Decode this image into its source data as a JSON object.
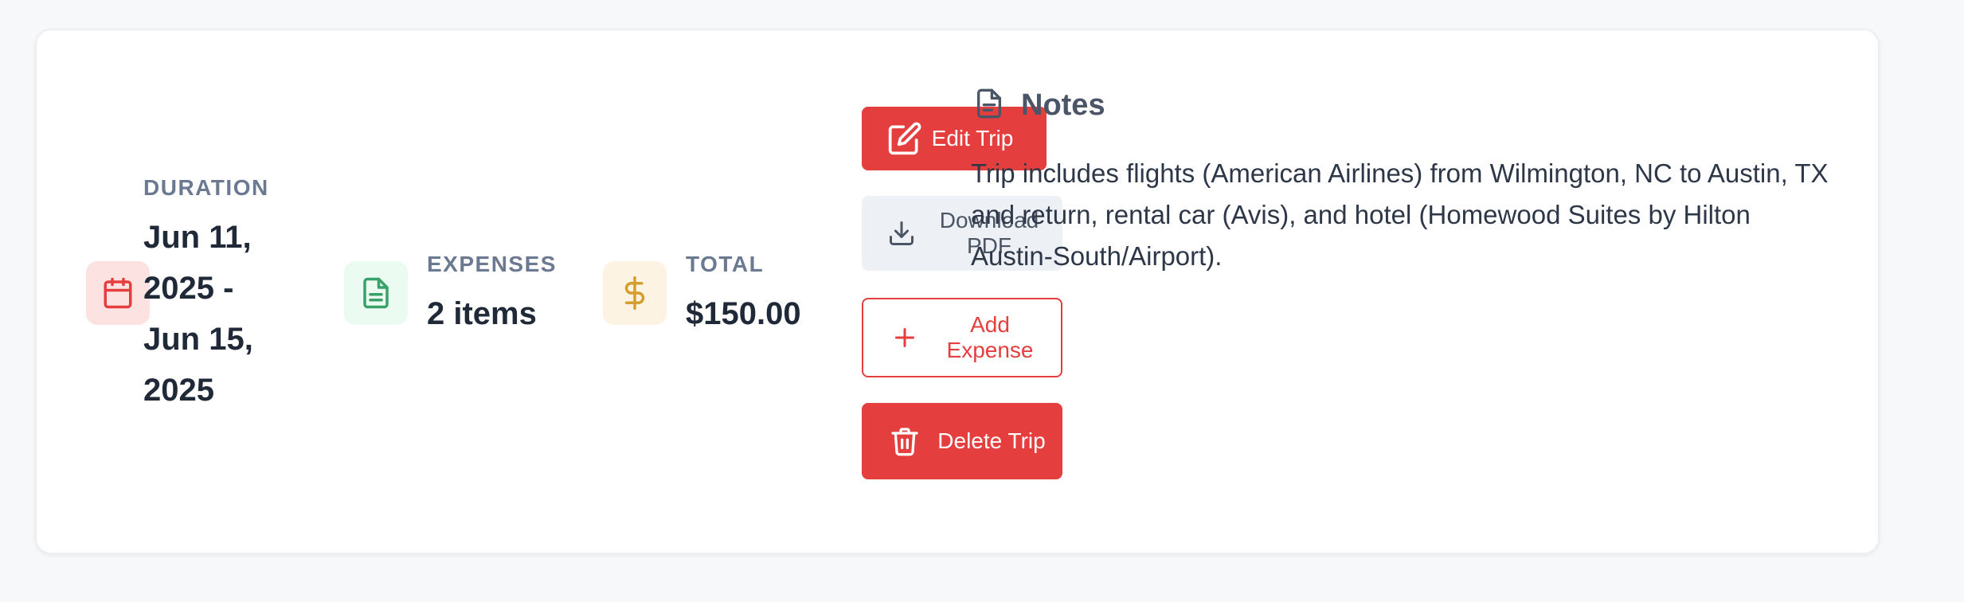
{
  "stats": [
    {
      "label": "DURATION",
      "value": "Jun 11, 2025 - Jun 15, 2025",
      "icon": "calendar-icon",
      "color": "#e53e3e",
      "bg": "#fde2e2"
    },
    {
      "label": "EXPENSES",
      "value": "2 items",
      "icon": "file-text-icon",
      "color": "#38a169",
      "bg": "#ecfbf1"
    },
    {
      "label": "TOTAL",
      "value": "$150.00",
      "icon": "dollar-icon",
      "color": "#d69e2e",
      "bg": "#fdf3e3"
    }
  ],
  "actions": {
    "edit": {
      "label": "Edit Trip",
      "icon": "edit-icon"
    },
    "download": {
      "label": "Download PDF",
      "icon": "download-icon"
    },
    "add_expense": {
      "label": "Add Expense",
      "icon": "plus-icon"
    },
    "delete": {
      "label": "Delete Trip",
      "icon": "trash-icon"
    }
  },
  "notes": {
    "title": "Notes",
    "icon": "document-icon",
    "text": "Trip includes flights (American Airlines) from Wilmington, NC to Austin, TX and return, rental car (Avis), and hotel (Homewood Suites by Hilton Austin-South/Airport)."
  },
  "colors": {
    "accent_red": "#e53e3e",
    "muted_label": "#6b7a90",
    "text_dark": "#1f2937"
  }
}
